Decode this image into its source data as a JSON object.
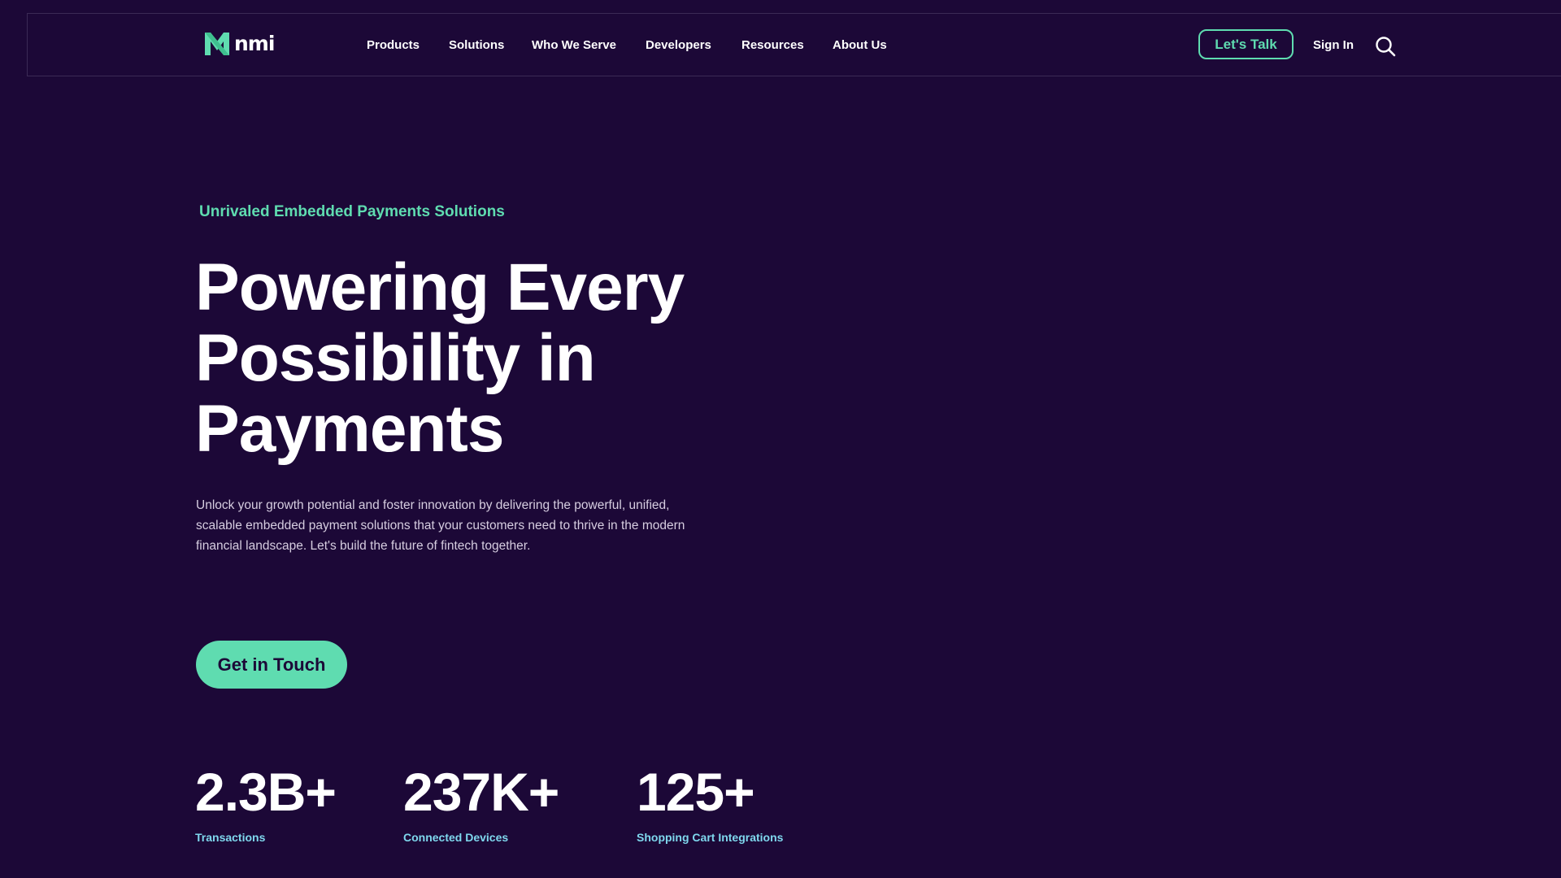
{
  "header": {
    "logo_text": "nmi",
    "nav": [
      {
        "label": "Products"
      },
      {
        "label": "Solutions"
      },
      {
        "label": "Who We Serve"
      },
      {
        "label": "Developers"
      },
      {
        "label": "Resources"
      },
      {
        "label": "About Us"
      }
    ],
    "lets_talk_label": "Let's Talk",
    "sign_in_label": "Sign In",
    "search_icon": "search-icon"
  },
  "hero": {
    "eyebrow": "Unrivaled Embedded Payments Solutions",
    "headline_lines": [
      "Powering Every",
      "Possibility in",
      "Payments"
    ],
    "description": "Unlock your growth potential and foster innovation by delivering the powerful, unified, scalable embedded payment solutions that your customers need to thrive in the modern financial landscape. Let's build the future of fintech together.",
    "cta_label": "Get in Touch"
  },
  "stats": [
    {
      "value": "2.3B+",
      "label": "Transactions"
    },
    {
      "value": "237K+",
      "label": "Connected Devices"
    },
    {
      "value": "125+",
      "label": "Shopping Cart Integrations"
    }
  ],
  "colors": {
    "background": "#1c0837",
    "accent": "#5fdcb0",
    "stat_label": "#7fd8ee",
    "body_text": "#d6cde0"
  }
}
